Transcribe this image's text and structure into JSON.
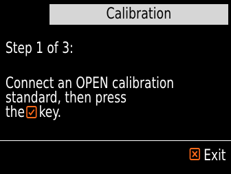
{
  "title": "Calibration",
  "step": "Step 1 of 3:",
  "instructions": {
    "line1": "Connect an OPEN calibration",
    "line2": "standard, then press",
    "line3_before": "the",
    "line3_after": "key."
  },
  "inline_icon": "check-key-icon",
  "exit": {
    "label": "Exit",
    "icon": "x-key-icon"
  },
  "colors": {
    "title_bar": "#d6d6d6",
    "accent_orange": "#ff6a1a",
    "background": "#000000",
    "text": "#ffffff"
  }
}
